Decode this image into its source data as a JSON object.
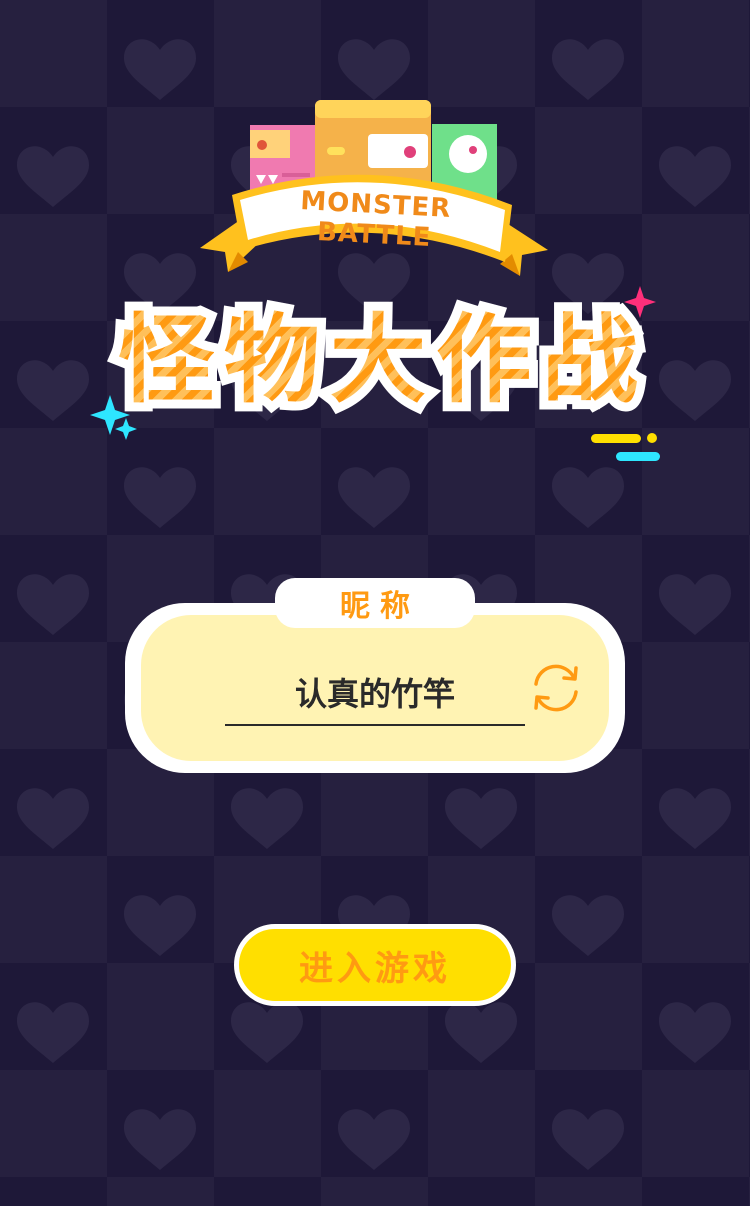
{
  "logo": {
    "ribbon_text": "MONSTER BATTLE",
    "title_chars": [
      "怪",
      "物",
      "大",
      "作",
      "战"
    ]
  },
  "nickname": {
    "label": "昵称",
    "value": "认真的竹竿"
  },
  "actions": {
    "start_label": "进入游戏"
  },
  "colors": {
    "background_dark": "#1e1838",
    "background_light": "#26203f",
    "accent_orange": "#ff9a12",
    "button_yellow": "#ffdf00",
    "field_yellow": "#fff3b3",
    "sparkle_pink": "#ff2f7a",
    "sparkle_cyan": "#2ee6ff"
  },
  "icons": {
    "refresh": "refresh-icon",
    "heart": "heart-icon",
    "sparkle": "sparkle-icon"
  }
}
